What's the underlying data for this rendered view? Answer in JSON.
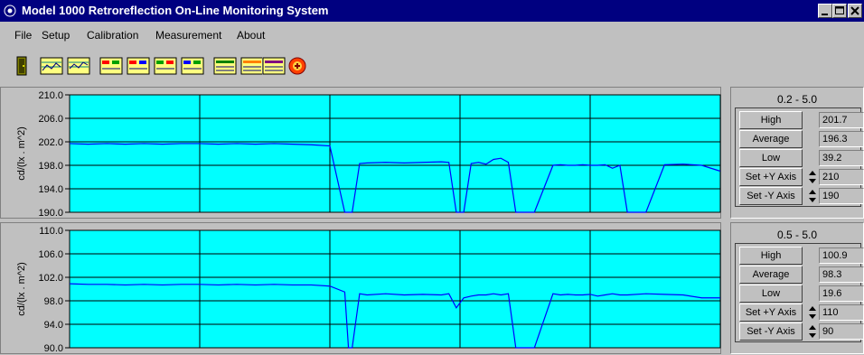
{
  "window": {
    "title": "Model 1000 Retroreflection On-Line Monitoring System",
    "title_bg": "#000080"
  },
  "menu": [
    "File",
    "Setup",
    "Calibration",
    "Measurement",
    "About"
  ],
  "toolbar": {
    "icons": [
      "exit-door-icon",
      "chart-view-icon",
      "chart-view-icon",
      "chart-settings-icon",
      "chart-settings-icon",
      "chart-settings-icon",
      "chart-settings-icon",
      "chart-data-icon",
      "chart-data-icon",
      "chart-data-icon",
      "stop-icon"
    ]
  },
  "chart_data": [
    {
      "type": "line",
      "title": "",
      "xlabel": "",
      "ylabel": "cd/(lx . m^2)",
      "ylim": [
        190,
        210
      ],
      "yticks": [
        "210.0",
        "206.0",
        "202.0",
        "198.0",
        "194.0",
        "190.0"
      ],
      "grid": true,
      "background": "#00ffff",
      "line_color": "#0000ff",
      "x": [
        0,
        5,
        10,
        15,
        20,
        25,
        30,
        35,
        40,
        45,
        50,
        55,
        60,
        65,
        70,
        74,
        76,
        78,
        80,
        85,
        90,
        95,
        100,
        102,
        104,
        106,
        108,
        110,
        112,
        114,
        116,
        118,
        120,
        125,
        130,
        132,
        134,
        136,
        138,
        140,
        142,
        144,
        146,
        148,
        150,
        155,
        160,
        165,
        170,
        175
      ],
      "values": [
        201.7,
        201.6,
        201.7,
        201.6,
        201.7,
        201.6,
        201.7,
        201.7,
        201.6,
        201.7,
        201.6,
        201.7,
        201.6,
        201.5,
        201.3,
        190,
        190,
        198.3,
        198.4,
        198.5,
        198.4,
        198.5,
        198.6,
        198.5,
        190,
        190,
        198.3,
        198.5,
        198.2,
        199.0,
        199.2,
        198.5,
        190,
        190,
        198.0,
        198.1,
        198.0,
        198.0,
        198.1,
        198.0,
        198.0,
        198.1,
        197.5,
        198.0,
        190,
        190,
        198.1,
        198.2,
        198.0,
        197.0
      ]
    },
    {
      "type": "line",
      "title": "",
      "xlabel": "",
      "ylabel": "cd/(lx . m^2)",
      "ylim": [
        90,
        110
      ],
      "yticks": [
        "110.0",
        "106.0",
        "102.0",
        "98.0",
        "94.0",
        "90.0"
      ],
      "grid": true,
      "background": "#00ffff",
      "line_color": "#0000ff",
      "x": [
        0,
        5,
        10,
        15,
        20,
        25,
        30,
        35,
        40,
        45,
        50,
        55,
        60,
        65,
        70,
        74,
        75,
        76,
        78,
        80,
        85,
        90,
        95,
        100,
        102,
        104,
        106,
        108,
        110,
        112,
        114,
        116,
        118,
        120,
        125,
        130,
        132,
        134,
        136,
        138,
        140,
        142,
        144,
        146,
        148,
        150,
        155,
        160,
        165,
        170,
        175
      ],
      "values": [
        100.9,
        100.8,
        100.8,
        100.7,
        100.8,
        100.7,
        100.8,
        100.8,
        100.7,
        100.8,
        100.7,
        100.8,
        100.7,
        100.7,
        100.5,
        99.5,
        90,
        90,
        99.2,
        99.0,
        99.2,
        99.0,
        99.1,
        99.0,
        99.2,
        96.8,
        98.5,
        98.8,
        99.0,
        99.0,
        99.2,
        99.0,
        99.2,
        90,
        90,
        99.2,
        99.0,
        99.1,
        99.0,
        99.0,
        99.1,
        98.8,
        99.0,
        99.2,
        99.0,
        99.0,
        99.2,
        99.1,
        99.0,
        98.5,
        98.5
      ]
    }
  ],
  "panels": [
    {
      "range": "0.2 - 5.0",
      "high_label": "High",
      "high": "201.7",
      "avg_label": "Average",
      "avg": "196.3",
      "low_label": "Low",
      "low": "39.2",
      "sety_plus_label": "Set +Y Axis",
      "sety_plus": "210",
      "sety_minus_label": "Set -Y Axis",
      "sety_minus": "190"
    },
    {
      "range": "0.5 - 5.0",
      "high_label": "High",
      "high": "100.9",
      "avg_label": "Average",
      "avg": "98.3",
      "low_label": "Low",
      "low": "19.6",
      "sety_plus_label": "Set +Y Axis",
      "sety_plus": "110",
      "sety_minus_label": "Set -Y Axis",
      "sety_minus": "90"
    }
  ]
}
